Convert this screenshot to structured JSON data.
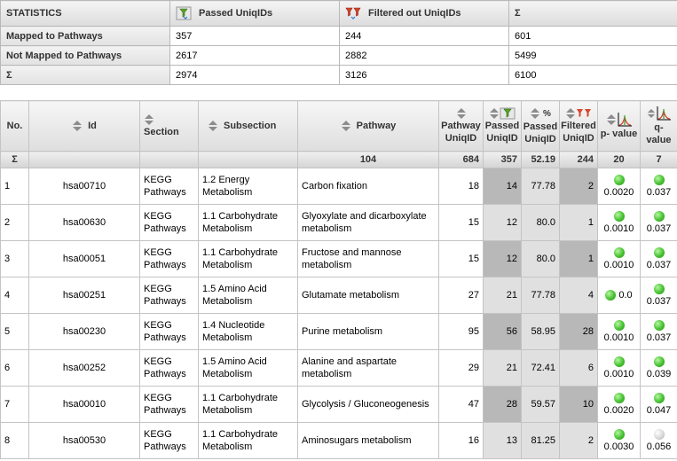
{
  "stats": {
    "header": {
      "label": "STATISTICS",
      "passed": "Passed UniqIDs",
      "filtered": "Filtered out UniqIDs",
      "sigma": "Σ"
    },
    "rows": [
      {
        "label": "Mapped to Pathways",
        "passed": "357",
        "filtered": "244",
        "total": "601"
      },
      {
        "label": "Not Mapped to Pathways",
        "passed": "2617",
        "filtered": "2882",
        "total": "5499"
      },
      {
        "label": "Σ",
        "passed": "2974",
        "filtered": "3126",
        "total": "6100"
      }
    ]
  },
  "pathways": {
    "headers": {
      "no": "No.",
      "id": "Id",
      "section": "Section",
      "subsection": "Subsection",
      "pathway": "Pathway",
      "pathway_uniqid": "Pathway UniqID",
      "passed_uniqid": "Passed UniqID",
      "passed_pct": "Passed UniqID",
      "filtered_uniqid": "Filtered UniqID",
      "pvalue": "p- value",
      "qvalue": "q- value",
      "pct_symbol": "%"
    },
    "sum": {
      "label": "Σ",
      "pathway": "104",
      "pathway_uniqid": "684",
      "passed": "357",
      "passed_pct": "52.19",
      "filtered": "244",
      "pvalue": "20",
      "qvalue": "7"
    },
    "rows": [
      {
        "no": "1",
        "id": "hsa00710",
        "section": "KEGG Pathways",
        "subsection": "1.2 Energy Metabolism",
        "pathway": "Carbon fixation",
        "uniq": "18",
        "passed": "14",
        "pct": "77.78",
        "filtered": "2",
        "pvalue": "0.0020",
        "qvalue": "0.037",
        "q_status": "green"
      },
      {
        "no": "2",
        "id": "hsa00630",
        "section": "KEGG Pathways",
        "subsection": "1.1 Carbohydrate Metabolism",
        "pathway": "Glyoxylate and dicarboxylate metabolism",
        "uniq": "15",
        "passed": "12",
        "pct": "80.0",
        "filtered": "1",
        "pvalue": "0.0010",
        "qvalue": "0.037",
        "q_status": "green"
      },
      {
        "no": "3",
        "id": "hsa00051",
        "section": "KEGG Pathways",
        "subsection": "1.1 Carbohydrate Metabolism",
        "pathway": "Fructose and mannose metabolism",
        "uniq": "15",
        "passed": "12",
        "pct": "80.0",
        "filtered": "1",
        "pvalue": "0.0010",
        "qvalue": "0.037",
        "q_status": "green"
      },
      {
        "no": "4",
        "id": "hsa00251",
        "section": "KEGG Pathways",
        "subsection": "1.5 Amino Acid Metabolism",
        "pathway": "Glutamate metabolism",
        "uniq": "27",
        "passed": "21",
        "pct": "77.78",
        "filtered": "4",
        "pvalue": "0.0",
        "qvalue": "0.037",
        "q_status": "green",
        "p_inline": true
      },
      {
        "no": "5",
        "id": "hsa00230",
        "section": "KEGG Pathways",
        "subsection": "1.4 Nucleotide Metabolism",
        "pathway": "Purine metabolism",
        "uniq": "95",
        "passed": "56",
        "pct": "58.95",
        "filtered": "28",
        "pvalue": "0.0010",
        "qvalue": "0.037",
        "q_status": "green"
      },
      {
        "no": "6",
        "id": "hsa00252",
        "section": "KEGG Pathways",
        "subsection": "1.5 Amino Acid Metabolism",
        "pathway": "Alanine and aspartate metabolism",
        "uniq": "29",
        "passed": "21",
        "pct": "72.41",
        "filtered": "6",
        "pvalue": "0.0010",
        "qvalue": "0.039",
        "q_status": "green"
      },
      {
        "no": "7",
        "id": "hsa00010",
        "section": "KEGG Pathways",
        "subsection": "1.1 Carbohydrate Metabolism",
        "pathway": "Glycolysis / Gluconeogenesis",
        "uniq": "47",
        "passed": "28",
        "pct": "59.57",
        "filtered": "10",
        "pvalue": "0.0020",
        "qvalue": "0.047",
        "q_status": "green"
      },
      {
        "no": "8",
        "id": "hsa00530",
        "section": "KEGG Pathways",
        "subsection": "1.1 Carbohydrate Metabolism",
        "pathway": "Aminosugars metabolism",
        "uniq": "16",
        "passed": "13",
        "pct": "81.25",
        "filtered": "2",
        "pvalue": "0.0030",
        "qvalue": "0.056",
        "q_status": "grey"
      }
    ]
  },
  "colors": {
    "status_green": "#46c131",
    "status_grey": "#d8d8d8",
    "header_bg": "#dedede",
    "cell_dark": "#b8b8b8",
    "cell_light": "#e0e0e0"
  }
}
